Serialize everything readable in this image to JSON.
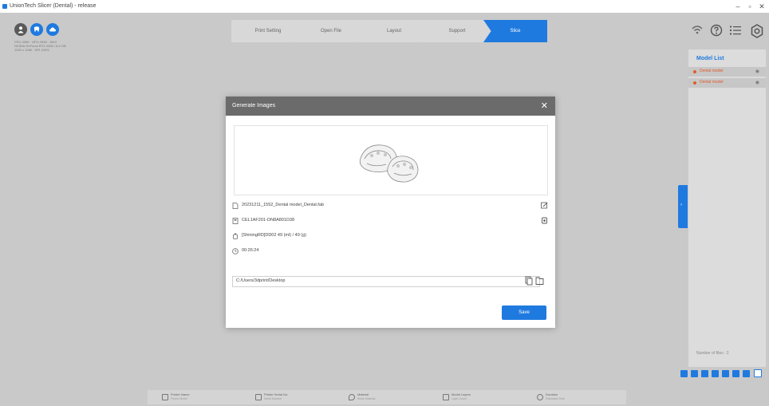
{
  "app": {
    "title": "UnionTech Slicer (Dental) - release",
    "window_controls": {
      "minimize": "–",
      "maximize": "▫",
      "close": "✕"
    }
  },
  "left_panel": {
    "system_info": [
      "CPU 4096 · GPU 2048 · 3M.0",
      "NVIDIA GeForce RTX 2060 / 8.6 GB",
      "1920 x 1080 · DPI 100%"
    ]
  },
  "workflow_steps": [
    {
      "label": "Print Setting"
    },
    {
      "label": "Open File"
    },
    {
      "label": "Layout"
    },
    {
      "label": "Support"
    },
    {
      "label": "Slice"
    }
  ],
  "model_list": {
    "title": "Model List",
    "items": [
      {
        "name": "Dental model"
      },
      {
        "name": "Dental model"
      }
    ],
    "footer": "Number of files : 2"
  },
  "status_bar": [
    {
      "title": "Printer Name",
      "sub": "Printer Model"
    },
    {
      "title": "Printer Serial No.",
      "sub": "Serial Number"
    },
    {
      "title": "Material",
      "sub": "Resin Material"
    },
    {
      "title": "Model Layers",
      "sub": "Layer Count"
    },
    {
      "title": "Duration",
      "sub": "Estimated Time"
    }
  ],
  "dialog": {
    "title": "Generate Images",
    "close": "✕",
    "file_name": "20231211_1552_Dental model_Dental.fab",
    "printer_id": "CEL1AF201-ON8A801D38",
    "material": "[ShiningRD]DD02  49 (ml) / 49 (g)",
    "duration": "00:26:24",
    "output_path": "C:/Users/3dprint/Desktop",
    "save_label": "Save"
  },
  "colors": {
    "accent": "#1f7ae0",
    "model_item": "#e25a2b",
    "dialog_header": "#6b6b6b"
  }
}
